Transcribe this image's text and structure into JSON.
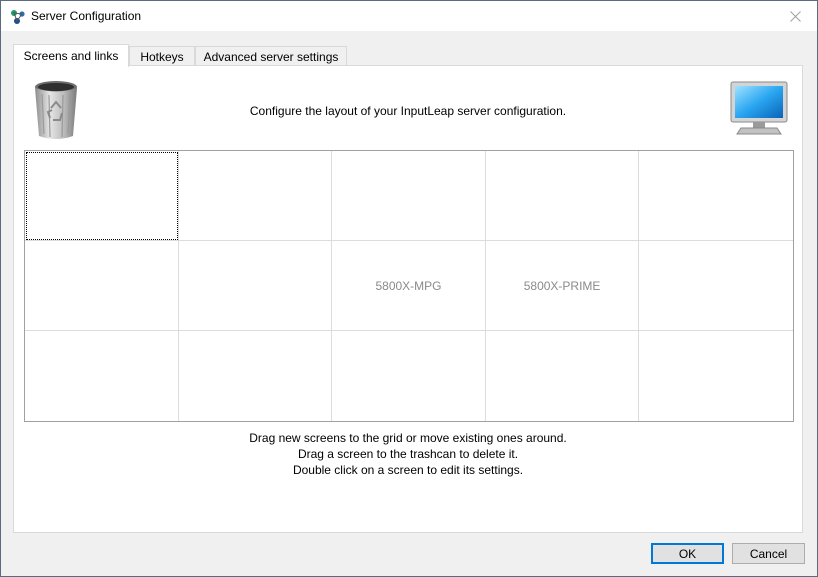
{
  "window": {
    "title": "Server Configuration"
  },
  "tabs": [
    {
      "label": "Screens and links",
      "active": true
    },
    {
      "label": "Hotkeys",
      "active": false
    },
    {
      "label": "Advanced server settings",
      "active": false
    }
  ],
  "panel": {
    "header": "Configure the layout of your InputLeap server configuration.",
    "grid": {
      "rows": [
        [
          "",
          "",
          "",
          "",
          ""
        ],
        [
          "",
          "",
          "5800X-MPG",
          "5800X-PRIME",
          ""
        ],
        [
          "",
          "",
          "",
          "",
          ""
        ]
      ]
    },
    "instructions": [
      "Drag new screens to the grid or move existing ones around.",
      "Drag a screen to the trashcan to delete it.",
      "Double click on a screen to edit its settings."
    ]
  },
  "buttons": {
    "ok": "OK",
    "cancel": "Cancel"
  },
  "colors": {
    "accent": "#0078d7",
    "window_bg": "#f0f0f0",
    "panel_bg": "#ffffff"
  }
}
